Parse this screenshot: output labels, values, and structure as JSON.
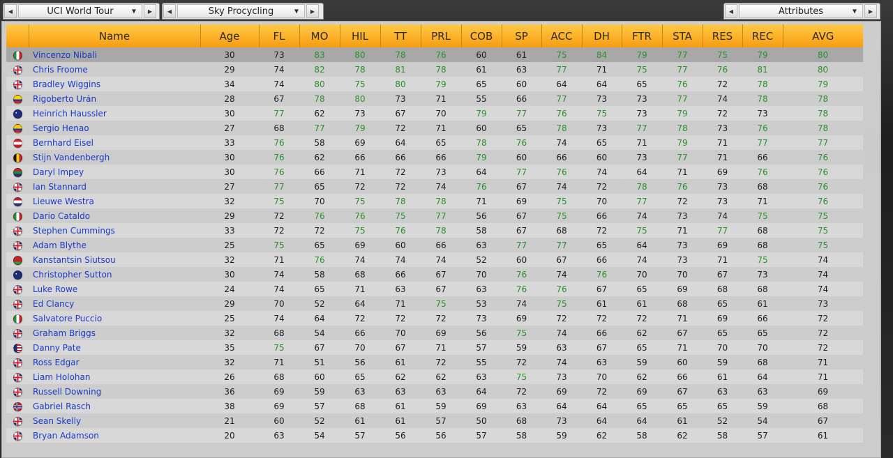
{
  "dropdowns": {
    "competition": {
      "label": "UCI World Tour"
    },
    "team": {
      "label": "Sky Procycling"
    },
    "view": {
      "label": "Attributes"
    }
  },
  "columns": [
    "",
    "Name",
    "Age",
    "FL",
    "MO",
    "HIL",
    "TT",
    "PRL",
    "COB",
    "SP",
    "ACC",
    "DH",
    "FTR",
    "STA",
    "RES",
    "REC",
    "AVG"
  ],
  "green_threshold": 75,
  "colors": {
    "header_top": "#ffc94a",
    "header_bottom": "#f59d13",
    "name_link": "#1b39c9",
    "good_value": "#2a8f2a",
    "selected_row": "#a8a8a8"
  },
  "flag_icons": {
    "ita": "italy-flag-icon",
    "gbr": "uk-flag-icon",
    "col": "colombia-flag-icon",
    "aus": "australia-flag-icon",
    "aut": "austria-flag-icon",
    "bel": "belgium-flag-icon",
    "rsa": "south-africa-flag-icon",
    "ned": "netherlands-flag-icon",
    "blr": "belarus-flag-icon",
    "usa": "usa-flag-icon",
    "nor": "norway-flag-icon"
  },
  "riders": [
    {
      "flag": "ita",
      "name": "Vincenzo Nibali",
      "age": "30",
      "stats": [
        "73",
        "83",
        "80",
        "78",
        "76",
        "60",
        "61",
        "75",
        "84",
        "79",
        "77",
        "75",
        "79"
      ],
      "avg": "80",
      "selected": true
    },
    {
      "flag": "gbr",
      "name": "Chris Froome",
      "age": "29",
      "stats": [
        "74",
        "82",
        "78",
        "81",
        "78",
        "61",
        "63",
        "77",
        "71",
        "75",
        "77",
        "76",
        "81"
      ],
      "avg": "80"
    },
    {
      "flag": "gbr",
      "name": "Bradley Wiggins",
      "age": "34",
      "stats": [
        "74",
        "80",
        "75",
        "80",
        "79",
        "65",
        "60",
        "64",
        "64",
        "65",
        "76",
        "72",
        "78"
      ],
      "avg": "79"
    },
    {
      "flag": "col",
      "name": "Rigoberto Urán",
      "age": "28",
      "stats": [
        "67",
        "78",
        "80",
        "73",
        "71",
        "55",
        "66",
        "77",
        "73",
        "73",
        "77",
        "74",
        "78"
      ],
      "avg": "78"
    },
    {
      "flag": "aus",
      "name": "Heinrich Haussler",
      "age": "30",
      "stats": [
        "77",
        "62",
        "73",
        "67",
        "70",
        "79",
        "77",
        "76",
        "75",
        "73",
        "79",
        "72",
        "73"
      ],
      "avg": "78"
    },
    {
      "flag": "col",
      "name": "Sergio Henao",
      "age": "27",
      "stats": [
        "68",
        "77",
        "79",
        "72",
        "71",
        "60",
        "65",
        "78",
        "73",
        "77",
        "78",
        "73",
        "76"
      ],
      "avg": "78"
    },
    {
      "flag": "aut",
      "name": "Bernhard Eisel",
      "age": "33",
      "stats": [
        "76",
        "58",
        "69",
        "64",
        "65",
        "78",
        "76",
        "74",
        "65",
        "71",
        "79",
        "71",
        "77"
      ],
      "avg": "77"
    },
    {
      "flag": "bel",
      "name": "Stijn Vandenbergh",
      "age": "30",
      "stats": [
        "76",
        "62",
        "66",
        "66",
        "66",
        "79",
        "60",
        "66",
        "60",
        "73",
        "77",
        "71",
        "66"
      ],
      "avg": "76"
    },
    {
      "flag": "rsa",
      "name": "Daryl Impey",
      "age": "30",
      "stats": [
        "76",
        "66",
        "71",
        "72",
        "73",
        "64",
        "77",
        "76",
        "74",
        "64",
        "71",
        "69",
        "76"
      ],
      "avg": "76"
    },
    {
      "flag": "gbr",
      "name": "Ian Stannard",
      "age": "27",
      "stats": [
        "77",
        "65",
        "72",
        "72",
        "74",
        "76",
        "67",
        "74",
        "72",
        "78",
        "76",
        "73",
        "68"
      ],
      "avg": "76"
    },
    {
      "flag": "ned",
      "name": "Lieuwe Westra",
      "age": "32",
      "stats": [
        "75",
        "70",
        "75",
        "78",
        "78",
        "71",
        "69",
        "75",
        "70",
        "77",
        "72",
        "73",
        "71"
      ],
      "avg": "76"
    },
    {
      "flag": "ita",
      "name": "Dario Cataldo",
      "age": "29",
      "stats": [
        "72",
        "76",
        "76",
        "75",
        "77",
        "56",
        "67",
        "75",
        "66",
        "74",
        "73",
        "74",
        "75"
      ],
      "avg": "75"
    },
    {
      "flag": "gbr",
      "name": "Stephen Cummings",
      "age": "33",
      "stats": [
        "72",
        "72",
        "75",
        "76",
        "78",
        "58",
        "67",
        "68",
        "72",
        "75",
        "71",
        "77",
        "68"
      ],
      "avg": "75"
    },
    {
      "flag": "gbr",
      "name": "Adam Blythe",
      "age": "25",
      "stats": [
        "75",
        "65",
        "69",
        "60",
        "66",
        "63",
        "77",
        "77",
        "65",
        "64",
        "73",
        "69",
        "68"
      ],
      "avg": "75"
    },
    {
      "flag": "blr",
      "name": "Kanstantsin Siutsou",
      "age": "32",
      "stats": [
        "71",
        "76",
        "74",
        "74",
        "74",
        "52",
        "60",
        "67",
        "66",
        "74",
        "73",
        "71",
        "75"
      ],
      "avg": "74"
    },
    {
      "flag": "aus",
      "name": "Christopher Sutton",
      "age": "30",
      "stats": [
        "74",
        "58",
        "68",
        "66",
        "67",
        "70",
        "76",
        "74",
        "76",
        "70",
        "70",
        "67",
        "73"
      ],
      "avg": "74"
    },
    {
      "flag": "gbr",
      "name": "Luke Rowe",
      "age": "24",
      "stats": [
        "74",
        "65",
        "71",
        "63",
        "67",
        "63",
        "76",
        "76",
        "67",
        "65",
        "69",
        "68",
        "68"
      ],
      "avg": "74"
    },
    {
      "flag": "gbr",
      "name": "Ed Clancy",
      "age": "29",
      "stats": [
        "70",
        "52",
        "64",
        "71",
        "75",
        "53",
        "74",
        "75",
        "61",
        "61",
        "68",
        "65",
        "61"
      ],
      "avg": "73"
    },
    {
      "flag": "ita",
      "name": "Salvatore Puccio",
      "age": "25",
      "stats": [
        "74",
        "64",
        "72",
        "72",
        "72",
        "73",
        "69",
        "72",
        "72",
        "72",
        "71",
        "69",
        "66"
      ],
      "avg": "72"
    },
    {
      "flag": "gbr",
      "name": "Graham Briggs",
      "age": "32",
      "stats": [
        "68",
        "54",
        "66",
        "70",
        "69",
        "56",
        "75",
        "74",
        "66",
        "62",
        "67",
        "65",
        "65"
      ],
      "avg": "72"
    },
    {
      "flag": "usa",
      "name": "Danny Pate",
      "age": "35",
      "stats": [
        "75",
        "67",
        "70",
        "67",
        "71",
        "57",
        "59",
        "63",
        "67",
        "65",
        "71",
        "70",
        "70"
      ],
      "avg": "72"
    },
    {
      "flag": "gbr",
      "name": "Ross Edgar",
      "age": "32",
      "stats": [
        "71",
        "51",
        "56",
        "61",
        "72",
        "55",
        "72",
        "74",
        "63",
        "59",
        "60",
        "59",
        "68"
      ],
      "avg": "71"
    },
    {
      "flag": "gbr",
      "name": "Liam Holohan",
      "age": "26",
      "stats": [
        "68",
        "60",
        "65",
        "62",
        "62",
        "63",
        "75",
        "73",
        "70",
        "62",
        "66",
        "61",
        "64"
      ],
      "avg": "71"
    },
    {
      "flag": "gbr",
      "name": "Russell Downing",
      "age": "36",
      "stats": [
        "69",
        "59",
        "63",
        "63",
        "63",
        "64",
        "72",
        "69",
        "72",
        "69",
        "67",
        "63",
        "63"
      ],
      "avg": "69"
    },
    {
      "flag": "nor",
      "name": "Gabriel Rasch",
      "age": "38",
      "stats": [
        "69",
        "57",
        "68",
        "61",
        "59",
        "69",
        "63",
        "64",
        "64",
        "65",
        "65",
        "65",
        "59"
      ],
      "avg": "68"
    },
    {
      "flag": "gbr",
      "name": "Sean Skelly",
      "age": "21",
      "stats": [
        "60",
        "52",
        "61",
        "61",
        "57",
        "50",
        "68",
        "73",
        "64",
        "64",
        "61",
        "52",
        "54"
      ],
      "avg": "67"
    },
    {
      "flag": "gbr",
      "name": "Bryan Adamson",
      "age": "20",
      "stats": [
        "63",
        "54",
        "57",
        "56",
        "56",
        "57",
        "58",
        "59",
        "62",
        "58",
        "62",
        "58",
        "57"
      ],
      "avg": "61"
    }
  ]
}
